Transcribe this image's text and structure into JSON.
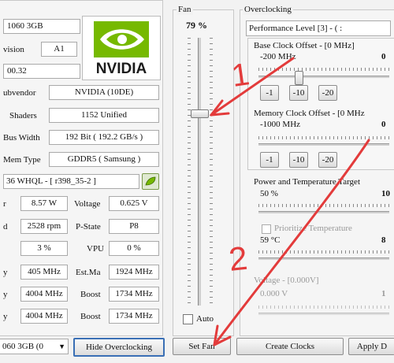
{
  "info": {
    "gpu_name": "1060 3GB",
    "revision_label": "vision",
    "revision_value": "A1",
    "bios": "00.32",
    "subvendor_label": "ubvendor",
    "subvendor_value": "NVIDIA (10DE)",
    "shaders_label": "Shaders",
    "shaders_value": "1152 Unified",
    "bus_label": "Bus Width",
    "bus_value": "192 Bit ( 192.2 GB/s )",
    "memtype_label": "Mem Type",
    "memtype_value": "GDDR5 ( Samsung )",
    "driver_value": "36 WHQL - [ r398_35-2 ]",
    "logo_text": "NVIDIA"
  },
  "stats": {
    "power_value": "8.57 W",
    "voltage_label": "Voltage",
    "voltage_value": "0.625 V",
    "fan_rpm": "2528 rpm",
    "pstate_label": "P-State",
    "pstate_value": "P8",
    "load_value": "3 %",
    "vpu_label": "VPU",
    "vpu_value": "0 %",
    "clock1": "405 MHz",
    "estmax_label": "Est.Ma",
    "estmax_value": "1924 MHz",
    "clock2": "4004 MHz",
    "boost_label": "Boost",
    "boost_value": "1734 MHz",
    "clock3": "4004 MHz",
    "boost2_label": "Boost",
    "boost2_value": "1734 MHz"
  },
  "fan": {
    "title": "Fan",
    "percent": "79 %",
    "level_fraction": 0.79,
    "auto_label": "Auto",
    "set_button": "Set Fan"
  },
  "overclocking": {
    "title": "Overclocking",
    "perf_level": "Performance Level [3] - ( :",
    "base_clock_label": "Base Clock Offset - [0 MHz]",
    "base_clock_value": "-200 MHz",
    "base_clock_max": "0",
    "mem_clock_label": "Memory Clock Offset - [0 MHz",
    "mem_clock_value": "-1000 MHz",
    "mem_clock_max": "0",
    "step_buttons": [
      "-1",
      "-10",
      "-20"
    ],
    "power_target_label": "Power and Temperature Target",
    "power_value": "50 %",
    "power_max": "10",
    "prioritize_label": "Prioritize Temperature",
    "temp_value": "59 °C",
    "temp_max": "8",
    "voltage_label": "Voltage - [0.000V]",
    "voltage_value": "0.000 V",
    "voltage_max": "1"
  },
  "bottom": {
    "gpu_select": "060 3GB (0",
    "hide_button": "Hide Overclocking",
    "create_button": "Create Clocks",
    "apply_button": "Apply D"
  },
  "annotations": {
    "mark_1": "1",
    "mark_2": "2"
  },
  "colors": {
    "annotation_red": "#e33b3b",
    "nvidia_green": "#76b900"
  }
}
